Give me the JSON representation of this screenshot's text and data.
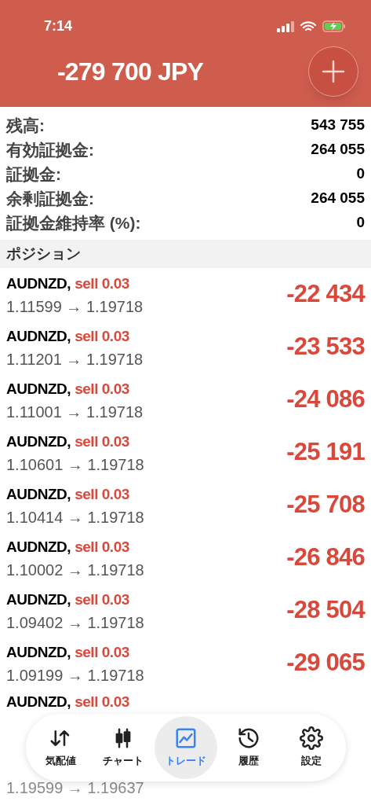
{
  "status_bar": {
    "time": "7:14",
    "charging": true
  },
  "header": {
    "balance": "-279 700 JPY"
  },
  "summary": [
    {
      "label": "残高:",
      "value": "543 755"
    },
    {
      "label": "有効証拠金:",
      "value": "264 055"
    },
    {
      "label": "証拠金:",
      "value": "0"
    },
    {
      "label": "余剰証拠金:",
      "value": "264 055"
    },
    {
      "label": "証拠金維持率 (%):",
      "value": "0"
    }
  ],
  "positions_title": "ポジション",
  "positions": [
    {
      "symbol": "AUDNZD,",
      "side": "sell 0.03",
      "prices": "1.11599 → 1.19718",
      "profit": "-22 434"
    },
    {
      "symbol": "AUDNZD,",
      "side": "sell 0.03",
      "prices": "1.11201 → 1.19718",
      "profit": "-23 533"
    },
    {
      "symbol": "AUDNZD,",
      "side": "sell 0.03",
      "prices": "1.11001 → 1.19718",
      "profit": "-24 086"
    },
    {
      "symbol": "AUDNZD,",
      "side": "sell 0.03",
      "prices": "1.10601 → 1.19718",
      "profit": "-25 191"
    },
    {
      "symbol": "AUDNZD,",
      "side": "sell 0.03",
      "prices": "1.10414 → 1.19718",
      "profit": "-25 708"
    },
    {
      "symbol": "AUDNZD,",
      "side": "sell 0.03",
      "prices": "1.10002 → 1.19718",
      "profit": "-26 846"
    },
    {
      "symbol": "AUDNZD,",
      "side": "sell 0.03",
      "prices": "1.09402 → 1.19718",
      "profit": "-28 504"
    },
    {
      "symbol": "AUDNZD,",
      "side": "sell 0.03",
      "prices": "1.09199 → 1.19718",
      "profit": "-29 065"
    },
    {
      "symbol": "AUDNZD,",
      "side": "sell 0.03"
    }
  ],
  "partial_row": {
    "prices": "1.19599 → 1.19637"
  },
  "tab_bar": [
    {
      "label": "気配値",
      "selected": false
    },
    {
      "label": "チャート",
      "selected": false
    },
    {
      "label": "トレード",
      "selected": true
    },
    {
      "label": "履歴",
      "selected": false
    },
    {
      "label": "設定",
      "selected": false
    }
  ]
}
